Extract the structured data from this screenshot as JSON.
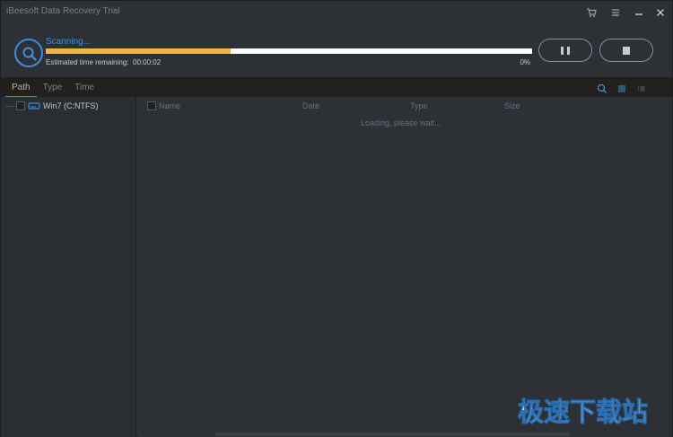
{
  "window": {
    "title": "iBeesoft Data Recovery Trial"
  },
  "scan": {
    "status": "Scanning...",
    "eta_label": "Estimated time remaining:",
    "eta_value": "00:00:02",
    "percent_label": "0%",
    "progress_fraction": 0.38
  },
  "tabs": [
    {
      "label": "Path",
      "active": true
    },
    {
      "label": "Type",
      "active": false
    },
    {
      "label": "Time",
      "active": false
    }
  ],
  "tree": {
    "items": [
      {
        "label": "Win7 (C:NTFS)"
      }
    ]
  },
  "file_list": {
    "columns": {
      "name": "Name",
      "date": "Date",
      "type": "Type",
      "size": "Size"
    },
    "loading_text": "Loading, please wait..."
  },
  "watermark": {
    "text": "极速下载站"
  },
  "colors": {
    "accent": "#3f8fd8",
    "progress": "#f2b640",
    "background": "#2d3035"
  }
}
